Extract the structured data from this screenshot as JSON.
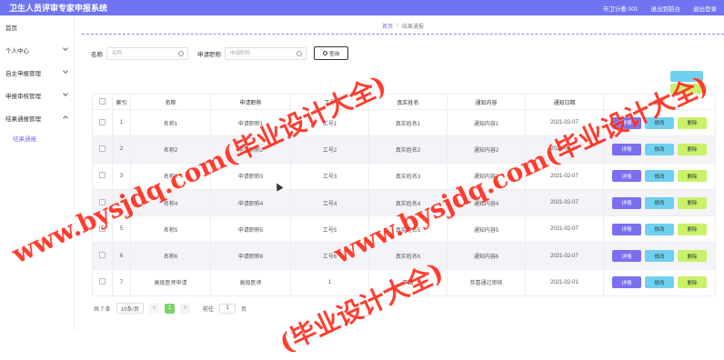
{
  "header": {
    "app_title": "卫生人员评审专家申报系统",
    "user": "市卫计委 001",
    "backend_label": "退出到前台",
    "logout_label": "退出登录"
  },
  "sidebar": {
    "items": [
      {
        "label": "首页"
      },
      {
        "label": "个人中心"
      },
      {
        "label": "自主申报管理"
      },
      {
        "label": "申报审核管理"
      },
      {
        "label": "结果通报管理"
      }
    ],
    "sub_item": "结果通报"
  },
  "breadcrumb": {
    "home": "首页",
    "sep": "/",
    "current": "结果通报"
  },
  "search": {
    "name_label": "名称",
    "name_placeholder": "名称",
    "title_label": "申请职称",
    "title_placeholder": "申请职称",
    "button_label": "查询"
  },
  "table": {
    "headers": [
      "",
      "索引",
      "名称",
      "申请职称",
      "工号",
      "真实姓名",
      "通知内容",
      "通知日期",
      "操作"
    ],
    "rows": [
      {
        "idx": "1",
        "name": "名称1",
        "title": "申请职称1",
        "no": "工号1",
        "real": "真实姓名1",
        "notice": "通知内容1",
        "date": "2021-02-07"
      },
      {
        "idx": "2",
        "name": "名称2",
        "title": "申请职称2",
        "no": "工号2",
        "real": "真实姓名2",
        "notice": "通知内容2",
        "date": "2021-02-07"
      },
      {
        "idx": "3",
        "name": "名称3",
        "title": "申请职称3",
        "no": "工号3",
        "real": "真实姓名3",
        "notice": "通知内容3",
        "date": "2021-02-07"
      },
      {
        "idx": "4",
        "name": "名称4",
        "title": "申请职称4",
        "no": "工号4",
        "real": "真实姓名4",
        "notice": "通知内容4",
        "date": "2021-02-07"
      },
      {
        "idx": "5",
        "name": "名称5",
        "title": "申请职称5",
        "no": "工号5",
        "real": "真实姓名5",
        "notice": "通知内容5",
        "date": "2021-02-07"
      },
      {
        "idx": "6",
        "name": "名称6",
        "title": "申请职称6",
        "no": "工号6",
        "real": "真实姓名6",
        "notice": "通知内容6",
        "date": "2021-02-07"
      },
      {
        "idx": "7",
        "name": "高级医师申请",
        "title": "高级医师",
        "no": "1",
        "real": "李娟",
        "notice": "恭喜通过审核",
        "date": "2021-02-01"
      }
    ],
    "op_detail": "详情",
    "op_edit": "修改",
    "op_delete": "删除"
  },
  "pager": {
    "total": "共 7 条",
    "size": "10条/页",
    "prev": "<",
    "page": "1",
    "next": ">",
    "goto": "前往",
    "goto_value": "1",
    "page_unit": "页"
  },
  "watermark": {
    "text1": "www.bysjdq.com(毕业设计大全)",
    "text2": "www.bysjdq.com(毕业设计大全)",
    "text3": "(毕业设计大全)"
  }
}
